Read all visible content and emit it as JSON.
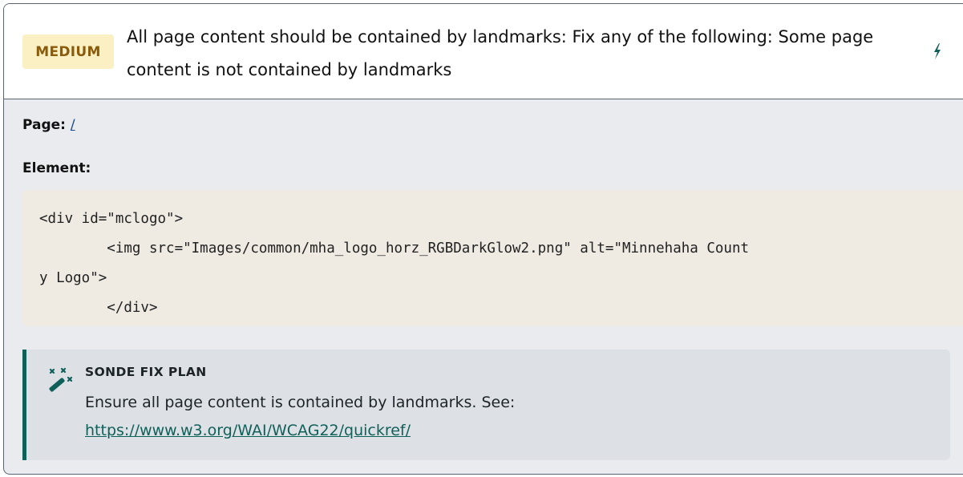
{
  "issue": {
    "severity": "MEDIUM",
    "title": "All page content should be contained by landmarks: Fix any of the following: Some page content is not contained by landmarks",
    "severity_colors": {
      "badge_bg": "#fbf0c4",
      "badge_text": "#8a5b0a"
    }
  },
  "details": {
    "page_label": "Page:",
    "page_value": "/",
    "element_label": "Element:",
    "code": "<div id=\"mclogo\">\n        <img src=\"Images/common/mha_logo_horz_RGBDarkGlow2.png\" alt=\"Minnehaha Count\ny Logo\">\n        </div>"
  },
  "fix_plan": {
    "heading": "SONDE FIX PLAN",
    "text": "Ensure all page content is contained by landmarks. See:",
    "link": "https://www.w3.org/WAI/WCAG22/quickref/",
    "accent_color": "#10605a"
  },
  "icons": {
    "header_action": "lightning-icon",
    "fix_plan": "magic-wand-icon"
  }
}
